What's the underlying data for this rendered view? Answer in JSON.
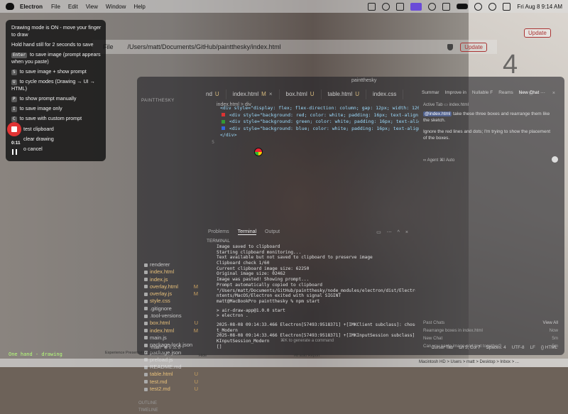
{
  "menubar": {
    "app": "Electron",
    "items": [
      "File",
      "Edit",
      "View",
      "Window",
      "Help"
    ],
    "datetime": "Fri Aug 8  9:14 AM"
  },
  "browser": {
    "file_label": "File",
    "url": "/Users/matt/Documents/GitHub/paintthesky/index.html",
    "update_label": "Update",
    "big_digit": "4"
  },
  "ide": {
    "title": "paintthesky",
    "tabs": [
      {
        "name": "nd",
        "status": "U"
      },
      {
        "name": "index.html",
        "status": "M"
      },
      {
        "name": "box.html",
        "status": "U"
      },
      {
        "name": "table.html",
        "status": "U"
      },
      {
        "name": "index.css",
        "status": ""
      }
    ],
    "breadcrumb": "index.html  >  div",
    "explorer_header": "PAINTTHESKY",
    "code_lines": [
      {
        "n": "",
        "text": "<div style=\"display: flex; flex-direction: column; gap: 12px; width: 120px;\">",
        "swatch": ""
      },
      {
        "n": "",
        "text": "  <div style=\"background: red; color: white; padding: 16px; text-align: cen",
        "swatch": "#d33"
      },
      {
        "n": "",
        "text": "  <div style=\"background: green; color: white; padding: 16px; text-align: ce",
        "swatch": "#393"
      },
      {
        "n": "",
        "text": "  <div style=\"background: blue; color: white; padding: 16px; text-align: cen",
        "swatch": "#36d"
      },
      {
        "n": "",
        "text": "</div>",
        "swatch": ""
      },
      {
        "n": "5",
        "text": "",
        "swatch": ""
      }
    ],
    "files": [
      {
        "name": "renderer",
        "status": "",
        "plain": true
      },
      {
        "name": "index.html",
        "status": "",
        "plain": false
      },
      {
        "name": "index.js",
        "status": "",
        "plain": false
      },
      {
        "name": "overlay.html",
        "status": "M",
        "plain": false
      },
      {
        "name": "overlay.js",
        "status": "M",
        "plain": false
      },
      {
        "name": "style.css",
        "status": "",
        "plain": false
      },
      {
        "name": ".gitignore",
        "status": "",
        "plain": true
      },
      {
        "name": ".tool-versions",
        "status": "",
        "plain": true
      },
      {
        "name": "box.html",
        "status": "U",
        "plain": false
      },
      {
        "name": "index.html",
        "status": "M",
        "plain": false
      },
      {
        "name": "main.js",
        "status": "",
        "plain": true
      },
      {
        "name": "package-lock.json",
        "status": "",
        "plain": true
      },
      {
        "name": "package.json",
        "status": "",
        "plain": true
      },
      {
        "name": "preload.js",
        "status": "",
        "plain": true
      },
      {
        "name": "README.md",
        "status": "",
        "plain": true
      },
      {
        "name": "table.html",
        "status": "U",
        "plain": false
      },
      {
        "name": "test.md",
        "status": "U",
        "plain": false
      },
      {
        "name": "test2.md",
        "status": "U",
        "plain": false
      }
    ],
    "outline": [
      "OUTLINE",
      "TIMELINE"
    ],
    "terminal": {
      "tabs": [
        "Problems",
        "Terminal",
        "Output"
      ],
      "label": "TERMINAL",
      "lines": [
        "Image saved to clipboard",
        "Starting clipboard monitoring...",
        "Text available but not saved to clipboard to preserve image",
        "Clipboard check 1/60",
        "Current clipboard image size: 62250",
        "Original image size: 02462",
        "Image was pasted! Showing prompt...",
        "Prompt automatically copied to clipboard",
        "\"/Users/matt/Documents/GitHub/paintthesky/node_modules/electron/dist/Electron.app/Co",
        "ntents/MacOS/Electron exited with signal SIGINT",
        "matt@MacBookPro paintthesky % npm start",
        "",
        "> air-draw-app@1.0.0 start",
        "> electron .",
        "",
        "2025-08-08 09:14:33.466 Electron[57493:9518371] +[IMKClient subclass]: chose IMKClien",
        "t_Modern",
        "2025-08-08 09:14:33.466 Electron[57493:9518371] +[IMKInputSession subclass]: chose IM",
        "KInputSession_Modern",
        "[]"
      ],
      "cmdk_hint": "⌘K to generate a command"
    },
    "chat": {
      "tabs": [
        "Summar",
        "Improve in",
        "Nullable F",
        "Reams",
        "New Chat"
      ],
      "active_tab": "Active Tab   ▭ index.html",
      "mention": "@index.html",
      "message1": " take these three boxes and rearrange them like the sketch.",
      "message2": "Ignore the red lines and dots; I'm trying to show the placement of the boxes.",
      "agent_row": "∞ Agent ⌘I     Auto",
      "past_header": "Past Chats",
      "view_all": "View All",
      "past_chats": [
        {
          "title": "Rearrange boxes in index.html",
          "when": "Now"
        },
        {
          "title": "New Chat",
          "when": "5m"
        },
        {
          "title": "Can you paste image and text together?",
          "when": "5m"
        }
      ]
    },
    "statusbar": {
      "left": "main*  ⊗ 0 ⚠ 0",
      "right": [
        "Cursor Tab",
        "Ln 5, Col 7",
        "Spaces: 4",
        "UTF-8",
        "LF",
        "{} HTML"
      ]
    }
  },
  "panel": {
    "line1": "Drawing mode is ON - move your finger to draw",
    "line2": "Hold hand still for 2 seconds to save",
    "key_enter": "Enter",
    "enter_desc": " to save image (prompt appears when you paste)",
    "key_s": "S",
    "s_desc": " to save image + show prompt",
    "key_u": "U",
    "u_desc": " to cycle modes (Drawing → UI → HTML)",
    "key_p": "P",
    "p_desc": " to show prompt manually",
    "key_i": "I",
    "i_desc": " to save image only",
    "key_c": "C",
    "c_desc": " to save with custom prompt",
    "t_desc": "test clipboard",
    "clear_desc": "clear drawing",
    "cancel_desc": "o cancel",
    "timer": "0:11"
  },
  "bottom": {
    "drawing_label": "One hand - drawing",
    "doc_snippet": "Experience Presentation with notes",
    "doc_snippet2": "Hide",
    "doc_snippet3": "#8 auto Report",
    "path_crumbs": "Macintosh HD > Users > matt > Desktop > Inbox > ..."
  },
  "colors": {
    "accent": "#e23434",
    "drawing_label": "#b6ff7a",
    "highlight": "#6a4bd8"
  }
}
